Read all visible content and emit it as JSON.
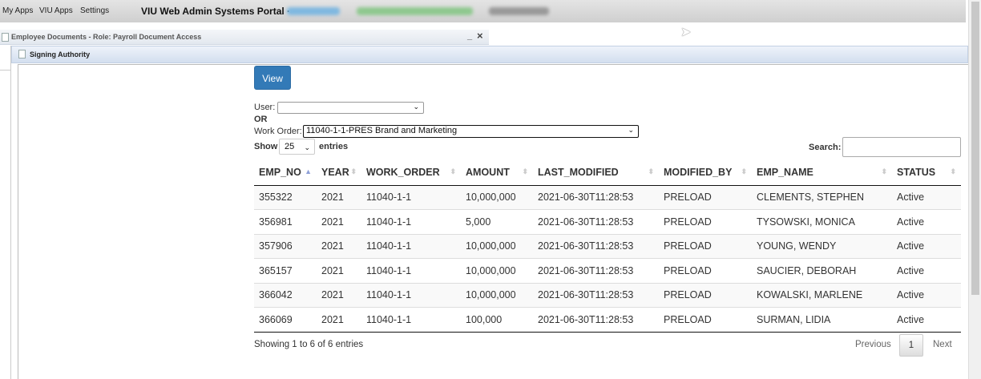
{
  "topbar": {
    "menu": [
      "My Apps",
      "VIU Apps",
      "Settings"
    ],
    "portal_title": "VIU Web Admin Systems Portal ·"
  },
  "window": {
    "title": "Employee Documents - Role: Payroll Document Access",
    "minimize": "_",
    "close": "×"
  },
  "panel": {
    "title": "Signing Authority"
  },
  "form": {
    "view_label": "View",
    "user_label": "User:",
    "user_value": "",
    "or_label": "OR",
    "work_order_label": "Work Order:",
    "work_order_value": "11040-1-1-PRES Brand and Marketing",
    "show_label": "Show",
    "entries_value": "25",
    "entries_label": "entries",
    "search_label": "Search:",
    "search_value": ""
  },
  "table": {
    "columns": [
      "EMP_NO",
      "YEAR",
      "WORK_ORDER",
      "AMOUNT",
      "LAST_MODIFIED",
      "MODIFIED_BY",
      "EMP_NAME",
      "STATUS"
    ],
    "sorted_column": "EMP_NO",
    "sort_direction": "ascending",
    "rows": [
      [
        "355322",
        "2021",
        "11040-1-1",
        "10,000,000",
        "2021-06-30T11:28:53",
        "PRELOAD",
        "CLEMENTS, STEPHEN",
        "Active"
      ],
      [
        "356981",
        "2021",
        "11040-1-1",
        "5,000",
        "2021-06-30T11:28:53",
        "PRELOAD",
        "TYSOWSKI, MONICA",
        "Active"
      ],
      [
        "357906",
        "2021",
        "11040-1-1",
        "10,000,000",
        "2021-06-30T11:28:53",
        "PRELOAD",
        "YOUNG, WENDY",
        "Active"
      ],
      [
        "365157",
        "2021",
        "11040-1-1",
        "10,000,000",
        "2021-06-30T11:28:53",
        "PRELOAD",
        "SAUCIER, DEBORAH",
        "Active"
      ],
      [
        "366042",
        "2021",
        "11040-1-1",
        "10,000,000",
        "2021-06-30T11:28:53",
        "PRELOAD",
        "KOWALSKI, MARLENE",
        "Active"
      ],
      [
        "366069",
        "2021",
        "11040-1-1",
        "100,000",
        "2021-06-30T11:28:53",
        "PRELOAD",
        "SURMAN, LIDIA",
        "Active"
      ]
    ]
  },
  "footer": {
    "info": "Showing 1 to 6 of 6 entries",
    "previous": "Previous",
    "page": "1",
    "next": "Next"
  },
  "colors": {
    "primary_button": "#337ab7"
  }
}
